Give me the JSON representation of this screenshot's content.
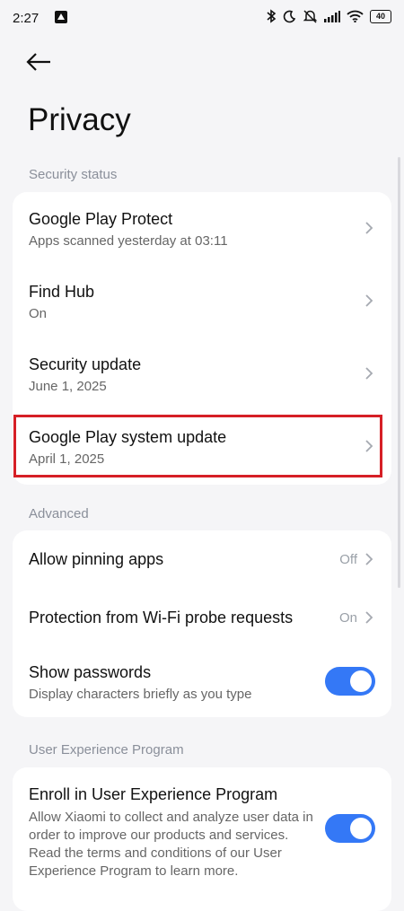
{
  "status_bar": {
    "time": "2:27",
    "left_icon": "notification-app-icon",
    "icons": [
      "bluetooth-icon",
      "do-not-disturb-moon-icon",
      "silent-bell-icon",
      "cellular-signal-icon",
      "wifi-icon"
    ],
    "battery": "40"
  },
  "header": {
    "back_icon": "back-arrow-icon",
    "title": "Privacy"
  },
  "sections": {
    "security_status": {
      "label": "Security status",
      "items": [
        {
          "title": "Google Play Protect",
          "subtitle": "Apps scanned yesterday at 03:11"
        },
        {
          "title": "Find Hub",
          "subtitle": "On"
        },
        {
          "title": "Security update",
          "subtitle": "June 1, 2025"
        },
        {
          "title": "Google Play system update",
          "subtitle": "April 1, 2025"
        }
      ]
    },
    "advanced": {
      "label": "Advanced",
      "items": [
        {
          "title": "Allow pinning apps",
          "value": "Off"
        },
        {
          "title": "Protection from Wi-Fi probe requests",
          "value": "On"
        },
        {
          "title": "Show passwords",
          "subtitle": "Display characters briefly as you type",
          "toggle": "on"
        }
      ]
    },
    "user_experience": {
      "label": "User Experience Program",
      "items": [
        {
          "title": "Enroll in User Experience Program",
          "subtitle": "Allow Xiaomi to collect and analyze user data in order to improve our products and services. Read the terms and conditions of our User Experience Program to learn more.",
          "toggle": "on"
        }
      ]
    }
  },
  "colors": {
    "accent": "#3478f6",
    "highlight": "#d61f26",
    "background": "#f5f5f7"
  }
}
